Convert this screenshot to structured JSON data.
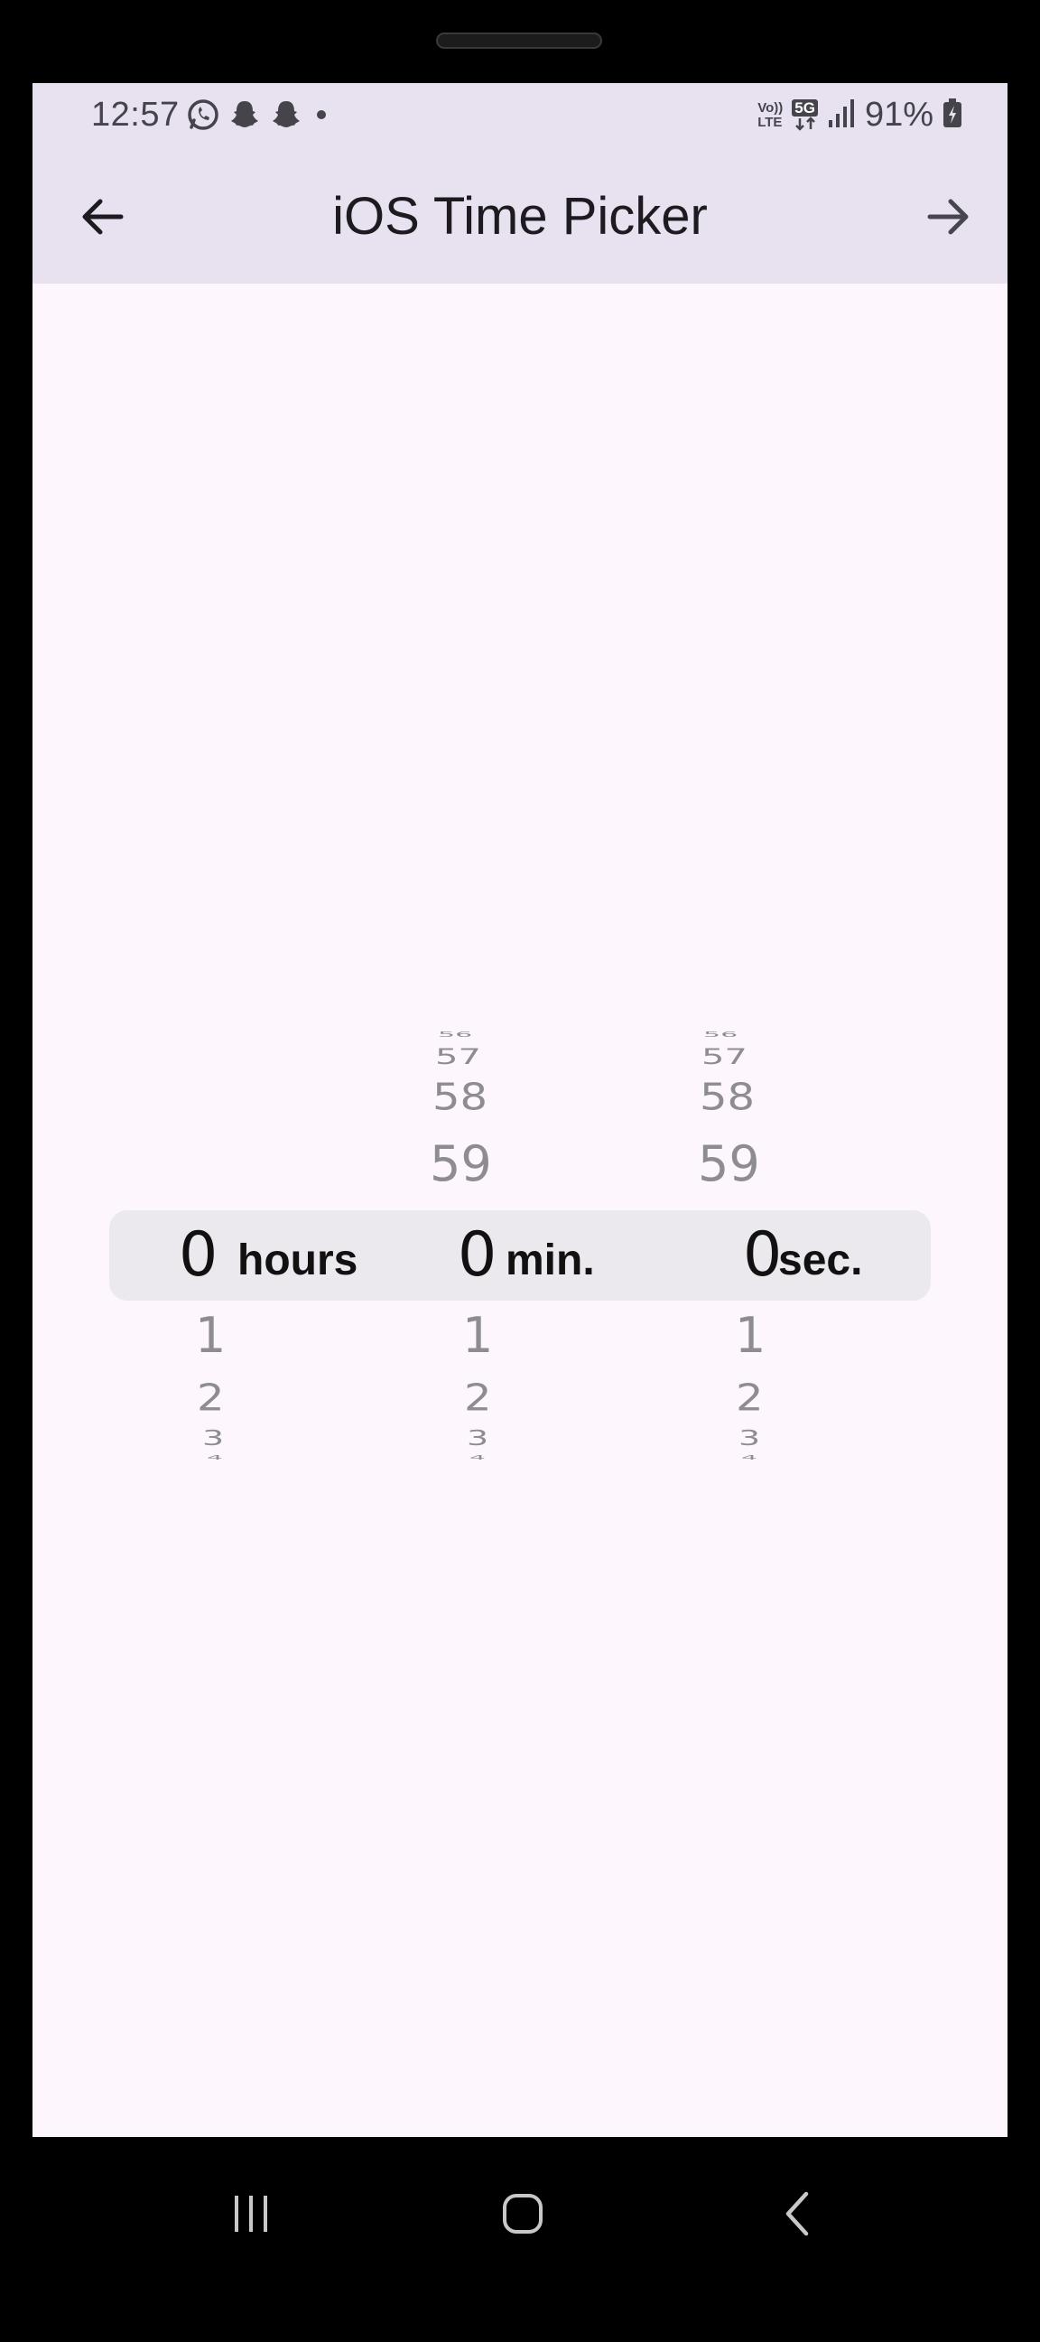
{
  "status_bar": {
    "time": "12:57",
    "battery": "91%",
    "network": "5G",
    "volte_line1": "Vo))",
    "volte_line2": "LTE",
    "icons_left": [
      "whatsapp-icon",
      "snapchat-icon",
      "snapchat-icon",
      "dot-icon"
    ],
    "icons_right": [
      "volte-icon",
      "5g-icon",
      "signal-icon",
      "battery-charging-icon"
    ]
  },
  "app_bar": {
    "title": "iOS Time Picker",
    "back_icon": "arrow-back-icon",
    "forward_icon": "arrow-forward-icon",
    "background": "#e8e1ef"
  },
  "picker": {
    "hours": {
      "above": [],
      "selected": "0",
      "unit": "hours",
      "below": [
        "1",
        "2",
        "3",
        "4"
      ]
    },
    "minutes": {
      "above": [
        "56",
        "57",
        "58",
        "59"
      ],
      "selected": "0",
      "unit": "min.",
      "below": [
        "1",
        "2",
        "3",
        "4"
      ]
    },
    "seconds": {
      "above": [
        "56",
        "57",
        "58",
        "59"
      ],
      "selected": "0",
      "unit": "sec.",
      "below": [
        "1",
        "2",
        "3",
        "4"
      ]
    },
    "highlight_color": "#ebe8ee",
    "unselected_color": "#8e8c92"
  },
  "nav_bar": {
    "recents_icon": "recents-icon",
    "home_icon": "home-icon",
    "back_icon": "back-chevron-icon"
  }
}
